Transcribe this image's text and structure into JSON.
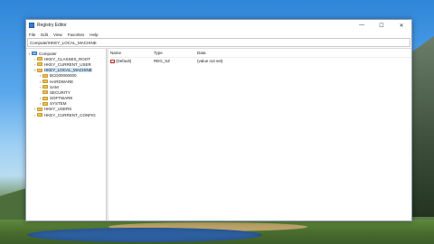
{
  "window": {
    "title": "Registry Editor",
    "controls": {
      "minimize": "—",
      "maximize": "☐",
      "close": "✕"
    }
  },
  "menu": [
    "File",
    "Edit",
    "View",
    "Favorites",
    "Help"
  ],
  "address": "Computer\\HKEY_LOCAL_MACHINE",
  "tree": [
    {
      "label": "Computer",
      "level": 0,
      "icon": "computer-icon",
      "arrow": "˅"
    },
    {
      "label": "HKEY_CLASSES_ROOT",
      "level": 1,
      "icon": "folder-icon",
      "arrow": "›"
    },
    {
      "label": "HKEY_CURRENT_USER",
      "level": 1,
      "icon": "folder-icon",
      "arrow": "›"
    },
    {
      "label": "HKEY_LOCAL_MACHINE",
      "level": 1,
      "icon": "folder-icon",
      "arrow": "˅",
      "selected": true
    },
    {
      "label": "BCD00000000",
      "level": 2,
      "icon": "folder-icon",
      "arrow": "›"
    },
    {
      "label": "HARDWARE",
      "level": 2,
      "icon": "folder-icon",
      "arrow": "›"
    },
    {
      "label": "SAM",
      "level": 2,
      "icon": "folder-icon",
      "arrow": "›"
    },
    {
      "label": "SECURITY",
      "level": 2,
      "icon": "folder-icon",
      "arrow": ""
    },
    {
      "label": "SOFTWARE",
      "level": 2,
      "icon": "folder-icon",
      "arrow": "›"
    },
    {
      "label": "SYSTEM",
      "level": 2,
      "icon": "folder-icon",
      "arrow": "›"
    },
    {
      "label": "HKEY_USERS",
      "level": 1,
      "icon": "folder-icon",
      "arrow": "›"
    },
    {
      "label": "HKEY_CURRENT_CONFIG",
      "level": 1,
      "icon": "folder-icon",
      "arrow": "›"
    }
  ],
  "values": {
    "headers": {
      "name": "Name",
      "type": "Type",
      "data": "Data"
    },
    "rows": [
      {
        "name": "(Default)",
        "type": "REG_SZ",
        "data": "(value not set)",
        "icon": "string-value-icon"
      }
    ]
  },
  "colors": {
    "selection": "#cce4f7",
    "folder": "#e8c05a",
    "window_border": "#8a9bb0"
  }
}
